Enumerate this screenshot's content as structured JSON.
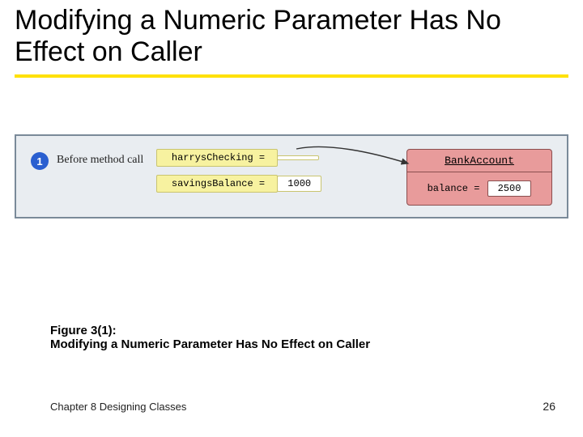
{
  "title": "Modifying a Numeric Parameter Has No Effect on Caller",
  "diagram": {
    "step_number": "1",
    "step_label": "Before method call",
    "vars": [
      {
        "name": "harrysChecking = ",
        "value": ""
      },
      {
        "name": "savingsBalance = ",
        "value": "1000"
      }
    ],
    "object": {
      "class_name": "BankAccount",
      "field_label": "balance = ",
      "field_value": "2500"
    }
  },
  "caption": {
    "ref": "Figure 3(1):",
    "title": "Modifying a Numeric Parameter Has No Effect on Caller"
  },
  "footer": "Chapter 8 ⮞ Designing Classes",
  "footer_display": "Chapter 8  Designing Classes",
  "page_number": "26"
}
